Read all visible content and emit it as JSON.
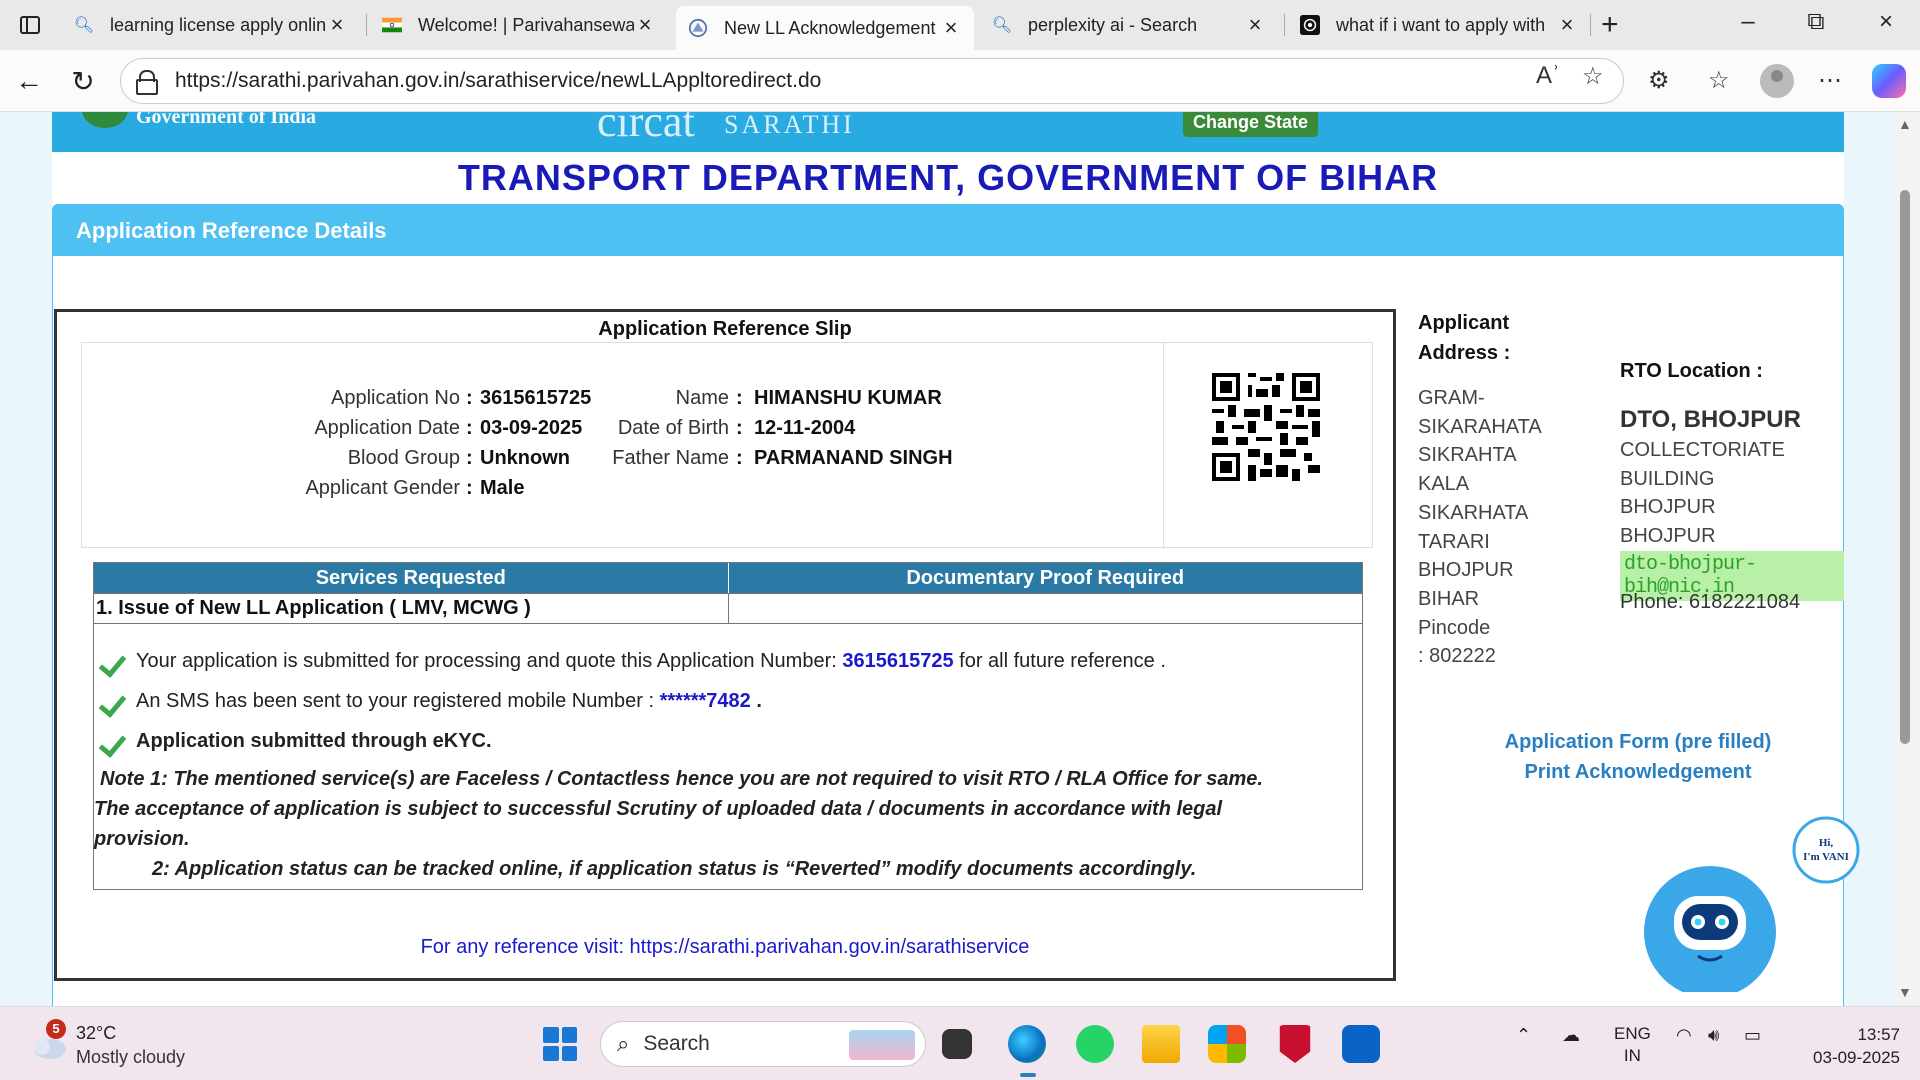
{
  "browser": {
    "tabs": [
      {
        "title": "learning license apply online",
        "favicon": "search-icon"
      },
      {
        "title": "Welcome! | Parivahansewa",
        "favicon": "india-flag-icon"
      },
      {
        "title": "New LL Acknowledgement",
        "favicon": "parivahan-icon",
        "active": true
      },
      {
        "title": "perplexity ai - Search",
        "favicon": "search-icon"
      },
      {
        "title": "what if i want to apply with",
        "favicon": "chatgpt-icon"
      }
    ],
    "url": "https://sarathi.parivahan.gov.in/sarathiservice/newLLAppltoredirect.do"
  },
  "page": {
    "banner": {
      "gov_text": "Government of India",
      "brand": "circat",
      "brand2": "SARATHI",
      "change_state": "Change State"
    },
    "department": "TRANSPORT DEPARTMENT, GOVERNMENT OF BIHAR",
    "panel_title": "Application Reference Details",
    "slip": {
      "title": "Application Reference Slip",
      "fields_left": [
        {
          "label": "Application No",
          "value": "3615615725"
        },
        {
          "label": "Application Date",
          "value": "03-09-2025"
        },
        {
          "label": "Blood Group",
          "value": "Unknown"
        },
        {
          "label": "Applicant Gender",
          "value": "Male"
        }
      ],
      "fields_right": [
        {
          "label": "Name",
          "value": "HIMANSHU KUMAR"
        },
        {
          "label": "Date of Birth",
          "value": "12-11-2004"
        },
        {
          "label": "Father Name",
          "value": "PARMANAND SINGH"
        }
      ],
      "colon": ":",
      "services_header": "Services Requested",
      "proof_header": "Documentary Proof Required",
      "service_item": "1. Issue of New LL Application ( LMV, MCWG )",
      "proof_item": "",
      "msg1_prefix": "Your application is submitted for processing and quote this Application Number:",
      "msg1_number": "3615615725",
      "msg1_suffix": "for all future reference .",
      "msg2_prefix": "An SMS has been sent to your registered mobile Number :",
      "msg2_number": "******7482",
      "msg2_suffix": ".",
      "msg3": "Application submitted through eKYC.",
      "note1": "Note 1:  The mentioned service(s) are Faceless / Contactless hence you are not required to visit RTO / RLA Office for same.",
      "note1b": "The acceptance of application is subject to successful Scrutiny of uploaded data / documents in accordance with legal",
      "note1c": "provision.",
      "note2": "2:  Application status can be tracked online, if application status is “Reverted” modify documents accordingly.",
      "ref_visit": "For any reference visit: https://sarathi.parivahan.gov.in/sarathiservice"
    },
    "address": {
      "title1": "Applicant",
      "title2": "Address :",
      "lines": [
        "GRAM-",
        "SIKARAHATA",
        "SIKRAHTA",
        "KALA",
        "SIKARHATA",
        "TARARI",
        "BHOJPUR",
        "BIHAR",
        "Pincode",
        ": 802222"
      ]
    },
    "rto": {
      "title": "RTO Location :",
      "name": "DTO, BHOJPUR",
      "lines": [
        "COLLECTORIATE",
        "BUILDING",
        "BHOJPUR",
        "BHOJPUR"
      ],
      "email": "dto-bhojpur-bih@nic.in",
      "phone": "Phone:  6182221084"
    },
    "links": {
      "form": "Application Form (pre filled)",
      "print": "Print Acknowledgement"
    },
    "vani": {
      "greeting": "Hi,",
      "name": "I'm VANI"
    }
  },
  "taskbar": {
    "weather_badge": "5",
    "temperature": "32°C",
    "weather": "Mostly cloudy",
    "search_placeholder": "Search",
    "lang1": "ENG",
    "lang2": "IN",
    "time": "13:57",
    "date": "03-09-2025"
  }
}
